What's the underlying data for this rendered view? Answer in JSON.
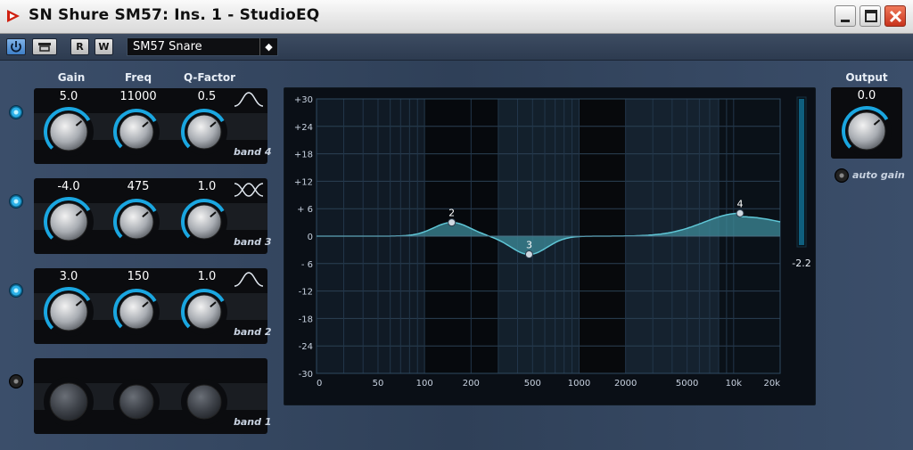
{
  "window": {
    "title": "SN Shure SM57: Ins. 1 - StudioEQ"
  },
  "toolbar": {
    "read_label": "R",
    "write_label": "W",
    "preset": "SM57 Snare"
  },
  "columns": {
    "gain": "Gain",
    "freq": "Freq",
    "q": "Q-Factor"
  },
  "bands": [
    {
      "label": "band 4",
      "gain": "5.0",
      "freq": "11000",
      "q": "0.5",
      "enabled": true
    },
    {
      "label": "band 3",
      "gain": "-4.0",
      "freq": "475",
      "q": "1.0",
      "enabled": true
    },
    {
      "label": "band 2",
      "gain": "3.0",
      "freq": "150",
      "q": "1.0",
      "enabled": true
    },
    {
      "label": "band 1",
      "gain": "",
      "freq": "",
      "q": "",
      "enabled": false
    }
  ],
  "graph": {
    "y_ticks": [
      "+30",
      "+24",
      "+18",
      "+12",
      "+ 6",
      "0",
      "- 6",
      "-12",
      "-18",
      "-24",
      "-30"
    ],
    "x_ticks": [
      "0",
      "50",
      "100",
      "200",
      "500",
      "1000",
      "2000",
      "5000",
      "10k",
      "20k"
    ],
    "markers": [
      {
        "id": "2",
        "freq": 150,
        "gain": 3.0
      },
      {
        "id": "3",
        "freq": 475,
        "gain": -4.0
      },
      {
        "id": "4",
        "freq": 11000,
        "gain": 5.0
      }
    ],
    "meter_value": "-2.2"
  },
  "output": {
    "label": "Output",
    "value": "0.0",
    "auto_gain_label": "auto gain"
  },
  "colors": {
    "accent": "#1aa6e0",
    "curve": "#5fc6d6",
    "curve_fill": "#3e8b9a"
  }
}
